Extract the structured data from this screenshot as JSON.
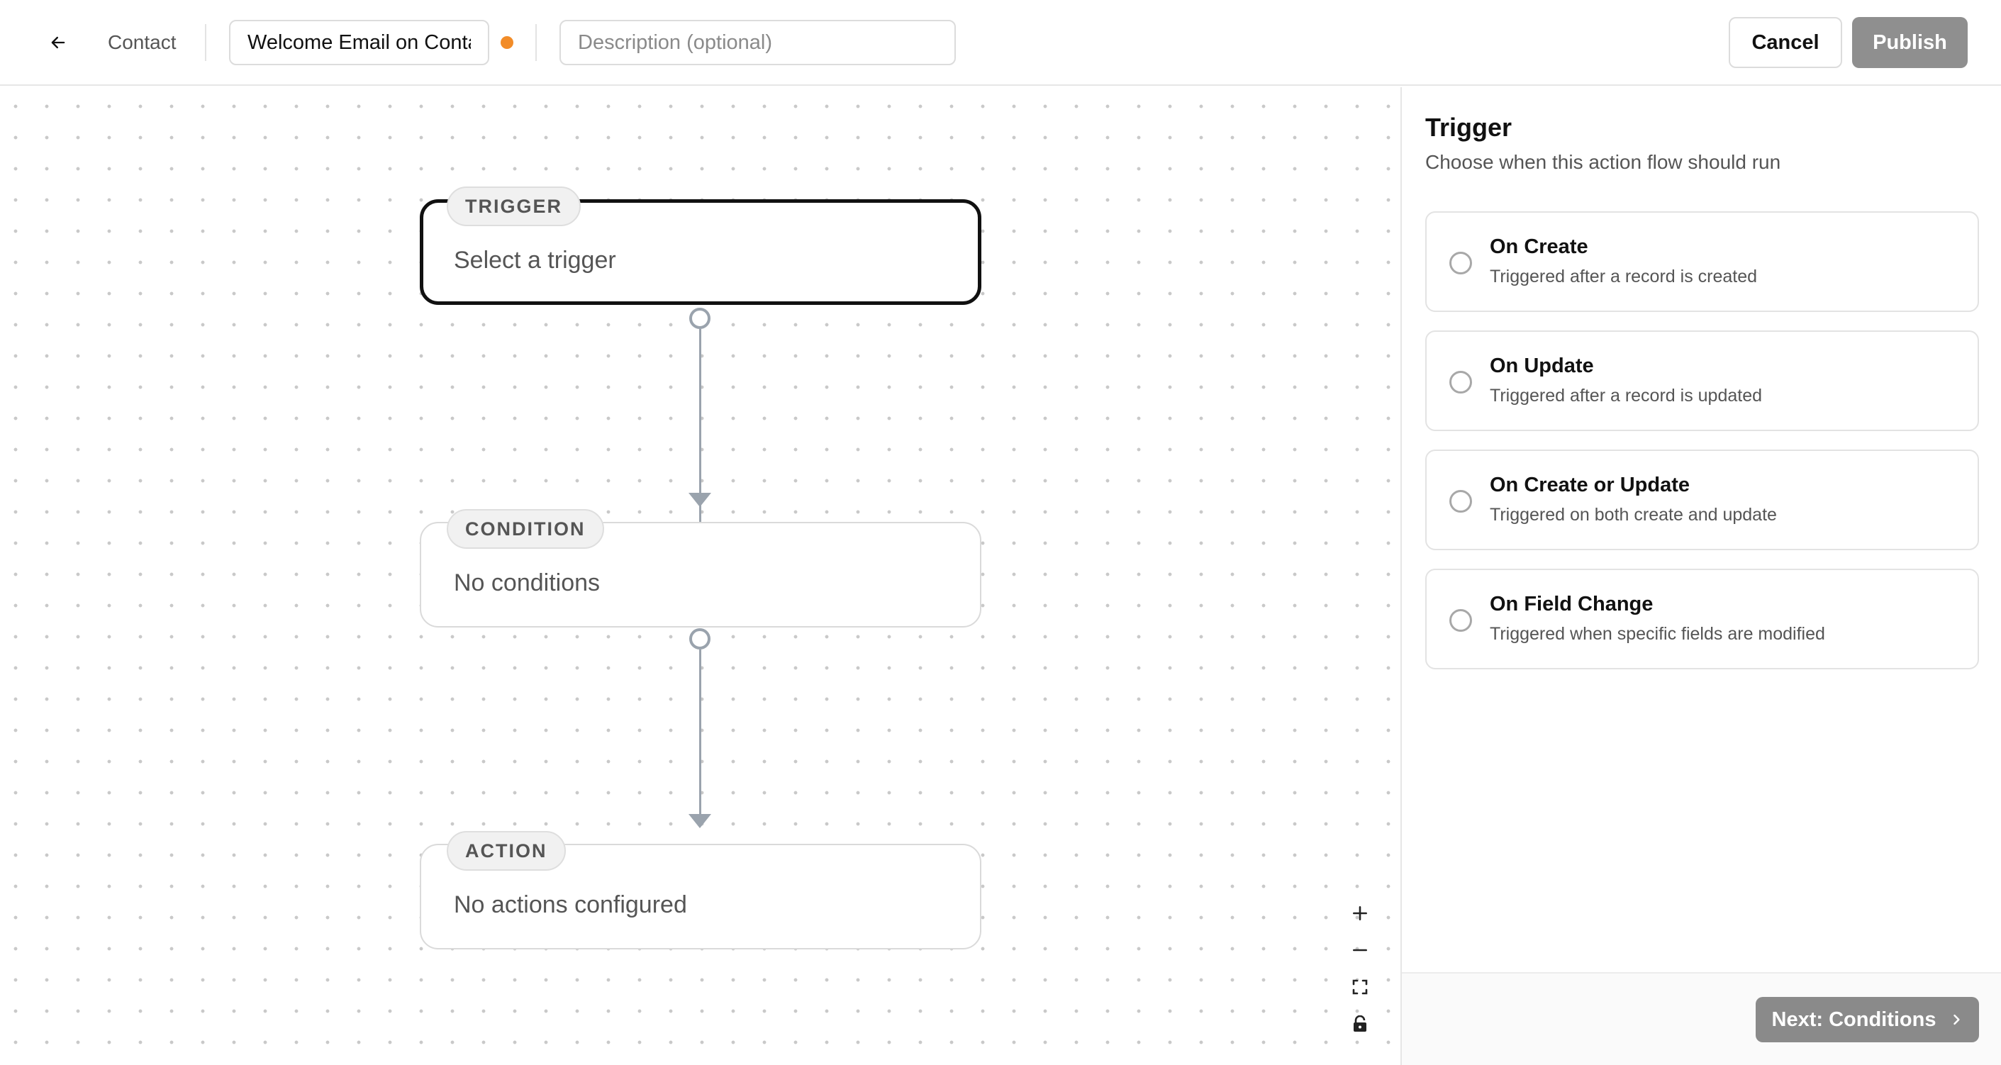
{
  "header": {
    "breadcrumb": "Contact",
    "flow_name": "Welcome Email on Contact Create",
    "description_placeholder": "Description (optional)",
    "cancel_label": "Cancel",
    "publish_label": "Publish",
    "back_icon": "arrow-left-icon",
    "unsaved_indicator_color": "#f28c28"
  },
  "canvas": {
    "nodes": [
      {
        "tag": "TRIGGER",
        "text": "Select a trigger",
        "selected": true
      },
      {
        "tag": "CONDITION",
        "text": "No conditions",
        "selected": false
      },
      {
        "tag": "ACTION",
        "text": "No actions configured",
        "selected": false
      }
    ],
    "controls": [
      "plus-icon",
      "minus-icon",
      "fit-view-icon",
      "lock-icon"
    ]
  },
  "panel": {
    "title": "Trigger",
    "subtitle": "Choose when this action flow should run",
    "options": [
      {
        "title": "On Create",
        "description": "Triggered after a record is created"
      },
      {
        "title": "On Update",
        "description": "Triggered after a record is updated"
      },
      {
        "title": "On Create or Update",
        "description": "Triggered on both create and update"
      },
      {
        "title": "On Field Change",
        "description": "Triggered when specific fields are modified"
      }
    ],
    "next_label": "Next: Conditions"
  },
  "colors": {
    "publish_disabled_bg": "#8f8f8f",
    "next_button_bg": "#8a8a8a",
    "edge": "#9aa3ad"
  }
}
